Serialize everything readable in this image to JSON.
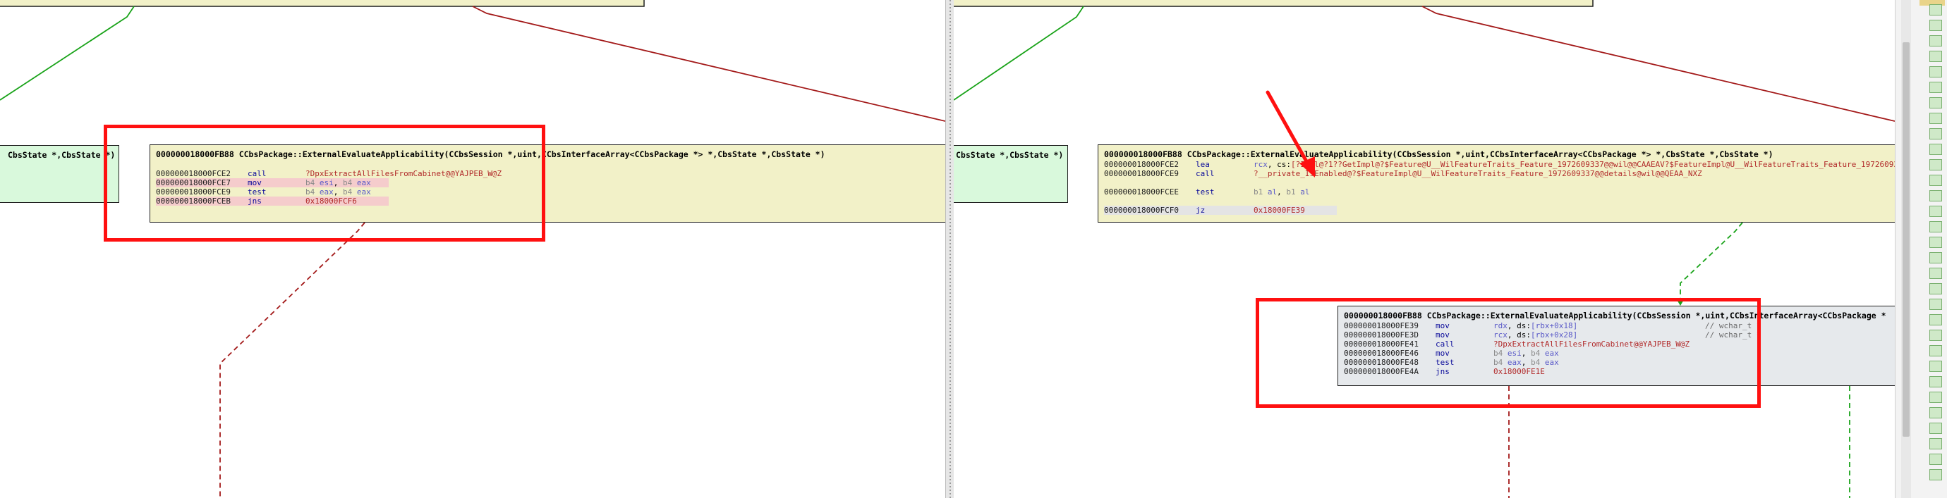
{
  "colors": {
    "edge_true": "#19a319",
    "edge_false": "#a31919",
    "annotation": "#ff1010",
    "node_yellow": "#f2f1c8",
    "node_green": "#d9f9dc",
    "node_grey": "#e6e9ec"
  },
  "left": {
    "fragment_label": "CbsState *,CbsState *)",
    "node_main": {
      "title": "000000018000FB88   CCbsPackage::ExternalEvaluateApplicability(CCbsSession *,uint,CCbsInterfaceArray<CCbsPackage *> *,CbsState *,CbsState *)",
      "rows": [
        {
          "addr": "000000018000FCE2",
          "mn": "call",
          "op": "?DpxExtractAllFilesFromCabinet@@YAJPEB_W@Z"
        },
        {
          "addr": "000000018000FCE7",
          "mn": "mov",
          "op_sz1": "b4",
          "op_r1": "esi",
          "op_sz2": "b4",
          "op_r2": "eax"
        },
        {
          "addr": "000000018000FCE9",
          "mn": "test",
          "op_sz1": "b4",
          "op_r1": "eax",
          "op_sz2": "b4",
          "op_r2": "eax"
        },
        {
          "addr": "000000018000FCEB",
          "mn": "jns",
          "op": "0x18000FCF6"
        }
      ]
    }
  },
  "right": {
    "fragment_label": "CbsState *,CbsState *)",
    "node_main": {
      "title": "000000018000FB88   CCbsPackage::ExternalEvaluateApplicability(CCbsSession *,uint,CCbsInterfaceArray<CCbsPackage *> *,CbsState *,CbsState *)",
      "rows": [
        {
          "addr": "000000018000FCE2",
          "mn": "lea",
          "op_r1": "rcx",
          "op_mid": "cs:",
          "op": "[?Impl@?1??GetImpl@?$Feature@U__WilFeatureTraits_Feature_1972609337@@wil@@CAAEAV?$FeatureImpl@U__WilFeatureTraits_Feature_1972609337"
        },
        {
          "addr": "000000018000FCE9",
          "mn": "call",
          "op": "?__private_IsEnabled@?$FeatureImpl@U__WilFeatureTraits_Feature_1972609337@@details@wil@@QEAA_NXZ"
        },
        {
          "addr": "000000018000FCEE",
          "mn": "test",
          "op_sz1": "b1",
          "op_r1": "al",
          "op_sz2": "b1",
          "op_r2": "al"
        },
        {
          "addr": "000000018000FCF0",
          "mn": "jz",
          "op": "0x18000FE39"
        }
      ]
    },
    "node_sub": {
      "title": "000000018000FB88   CCbsPackage::ExternalEvaluateApplicability(CCbsSession *,uint,CCbsInterfaceArray<CCbsPackage *",
      "rows": [
        {
          "addr": "000000018000FE39",
          "mn": "mov",
          "op_r1": "rdx",
          "op_mid": "ds:",
          "op_mem": "[rbx+0x18]",
          "comment": "// wchar_t *"
        },
        {
          "addr": "000000018000FE3D",
          "mn": "mov",
          "op_r1": "rcx",
          "op_mid": "ds:",
          "op_mem": "[rbx+0x28]",
          "comment": "// wchar_t *"
        },
        {
          "addr": "000000018000FE41",
          "mn": "call",
          "op": "?DpxExtractAllFilesFromCabinet@@YAJPEB_W@Z"
        },
        {
          "addr": "000000018000FE46",
          "mn": "mov",
          "op_sz1": "b4",
          "op_r1": "esi",
          "op_sz2": "b4",
          "op_r2": "eax"
        },
        {
          "addr": "000000018000FE48",
          "mn": "test",
          "op_sz1": "b4",
          "op_r1": "eax",
          "op_sz2": "b4",
          "op_r2": "eax"
        },
        {
          "addr": "000000018000FE4A",
          "mn": "jns",
          "op": "0x18000FE1E"
        }
      ]
    }
  }
}
